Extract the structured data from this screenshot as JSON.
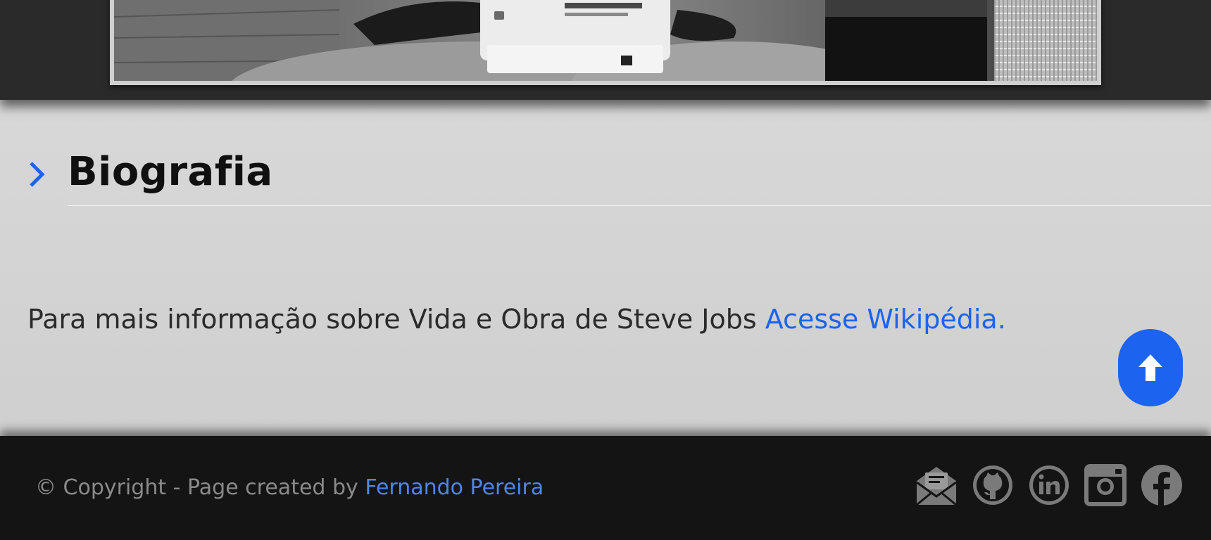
{
  "section": {
    "title": "Biografia",
    "info_text": "Para mais informação sobre Vida e Obra de Steve Jobs ",
    "info_link": "Acesse Wikipédia."
  },
  "footer": {
    "copyright_text": "© Copyright - Page created by ",
    "author_link": "Fernando Pereira",
    "social_icons": [
      "mail-icon",
      "github-icon",
      "linkedin-icon",
      "instagram-icon",
      "facebook-icon"
    ]
  },
  "colors": {
    "accent": "#1c63f0",
    "top_band": "#2a2a2a",
    "content_bg": "#d4d4d4",
    "footer_bg": "#141414",
    "footer_text": "#8a8a8a",
    "footer_link": "#4f86e8",
    "social_icon": "#7a7a7a"
  }
}
